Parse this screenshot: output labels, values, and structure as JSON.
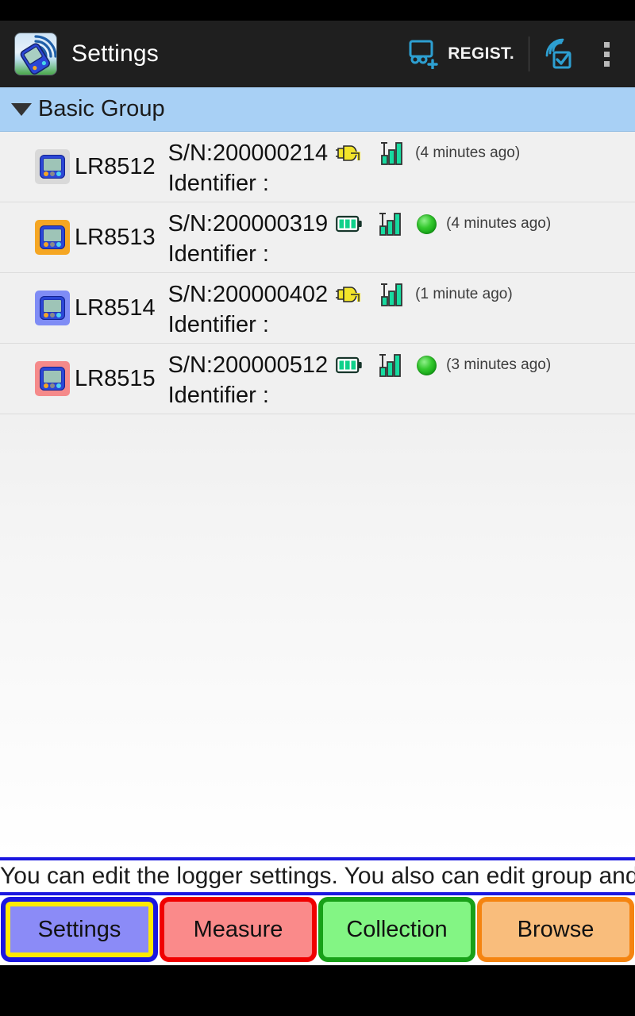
{
  "app": {
    "title": "Settings",
    "icon": "logger-wifi-app-icon"
  },
  "actionbar": {
    "regist_label": "REGIST.",
    "regist_icon": "add-logger-icon",
    "wifi_check_icon": "wifi-check-icon",
    "overflow_icon": "overflow-menu-icon"
  },
  "group": {
    "name": "Basic Group",
    "expanded": true,
    "caret_icon": "chevron-down-icon"
  },
  "devices": [
    {
      "model": "LR8512",
      "serial_label": "S/N:200000214",
      "identifier_label": "Identifier :",
      "power_icon": "ac-plug-icon",
      "signal_icon": "signal-bars-icon",
      "status_icon": "",
      "last_seen": "(4 minutes ago)",
      "icon_bg": "#d9d9d9"
    },
    {
      "model": "LR8513",
      "serial_label": "S/N:200000319",
      "identifier_label": "Identifier :",
      "power_icon": "battery-full-icon",
      "signal_icon": "signal-bars-icon",
      "status_icon": "recording-green-icon",
      "last_seen": "(4 minutes ago)",
      "icon_bg": "#f5a623"
    },
    {
      "model": "LR8514",
      "serial_label": "S/N:200000402",
      "identifier_label": "Identifier :",
      "power_icon": "ac-plug-icon",
      "signal_icon": "signal-bars-icon",
      "status_icon": "",
      "last_seen": "(1 minute ago)",
      "icon_bg": "#7f8cf5"
    },
    {
      "model": "LR8515",
      "serial_label": "S/N:200000512",
      "identifier_label": "Identifier :",
      "power_icon": "battery-full-icon",
      "signal_icon": "signal-bars-icon",
      "status_icon": "recording-green-icon",
      "last_seen": "(3 minutes ago)",
      "icon_bg": "#f58a8a"
    }
  ],
  "hint": {
    "text": "You can edit the logger settings. You also can edit group and"
  },
  "tabs": [
    {
      "label": "Settings",
      "selected": true
    },
    {
      "label": "Measure",
      "selected": false
    },
    {
      "label": "Collection",
      "selected": false
    },
    {
      "label": "Browse",
      "selected": false
    }
  ],
  "colors": {
    "actionbar_bg": "#1f1f1f",
    "group_header_bg": "#a8d0f5",
    "accent_blue": "#1a16e0",
    "selected_highlight": "#ffea00",
    "measure_red": "#f00000",
    "collection_green": "#18a018",
    "browse_orange": "#f58410"
  }
}
